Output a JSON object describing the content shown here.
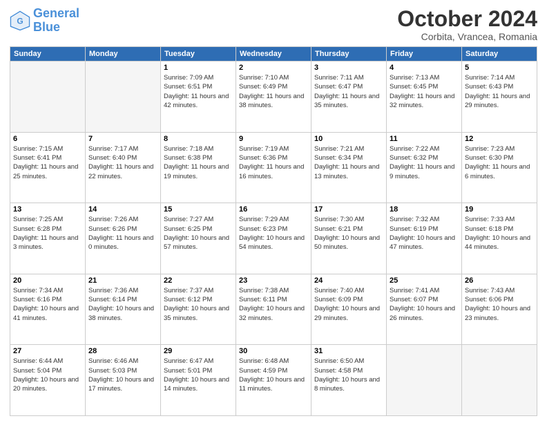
{
  "logo": {
    "line1": "General",
    "line2": "Blue"
  },
  "title": "October 2024",
  "subtitle": "Corbita, Vrancea, Romania",
  "days_header": [
    "Sunday",
    "Monday",
    "Tuesday",
    "Wednesday",
    "Thursday",
    "Friday",
    "Saturday"
  ],
  "weeks": [
    [
      {
        "day": "",
        "empty": true
      },
      {
        "day": "",
        "empty": true
      },
      {
        "day": "1",
        "sunrise": "Sunrise: 7:09 AM",
        "sunset": "Sunset: 6:51 PM",
        "daylight": "Daylight: 11 hours and 42 minutes."
      },
      {
        "day": "2",
        "sunrise": "Sunrise: 7:10 AM",
        "sunset": "Sunset: 6:49 PM",
        "daylight": "Daylight: 11 hours and 38 minutes."
      },
      {
        "day": "3",
        "sunrise": "Sunrise: 7:11 AM",
        "sunset": "Sunset: 6:47 PM",
        "daylight": "Daylight: 11 hours and 35 minutes."
      },
      {
        "day": "4",
        "sunrise": "Sunrise: 7:13 AM",
        "sunset": "Sunset: 6:45 PM",
        "daylight": "Daylight: 11 hours and 32 minutes."
      },
      {
        "day": "5",
        "sunrise": "Sunrise: 7:14 AM",
        "sunset": "Sunset: 6:43 PM",
        "daylight": "Daylight: 11 hours and 29 minutes."
      }
    ],
    [
      {
        "day": "6",
        "sunrise": "Sunrise: 7:15 AM",
        "sunset": "Sunset: 6:41 PM",
        "daylight": "Daylight: 11 hours and 25 minutes."
      },
      {
        "day": "7",
        "sunrise": "Sunrise: 7:17 AM",
        "sunset": "Sunset: 6:40 PM",
        "daylight": "Daylight: 11 hours and 22 minutes."
      },
      {
        "day": "8",
        "sunrise": "Sunrise: 7:18 AM",
        "sunset": "Sunset: 6:38 PM",
        "daylight": "Daylight: 11 hours and 19 minutes."
      },
      {
        "day": "9",
        "sunrise": "Sunrise: 7:19 AM",
        "sunset": "Sunset: 6:36 PM",
        "daylight": "Daylight: 11 hours and 16 minutes."
      },
      {
        "day": "10",
        "sunrise": "Sunrise: 7:21 AM",
        "sunset": "Sunset: 6:34 PM",
        "daylight": "Daylight: 11 hours and 13 minutes."
      },
      {
        "day": "11",
        "sunrise": "Sunrise: 7:22 AM",
        "sunset": "Sunset: 6:32 PM",
        "daylight": "Daylight: 11 hours and 9 minutes."
      },
      {
        "day": "12",
        "sunrise": "Sunrise: 7:23 AM",
        "sunset": "Sunset: 6:30 PM",
        "daylight": "Daylight: 11 hours and 6 minutes."
      }
    ],
    [
      {
        "day": "13",
        "sunrise": "Sunrise: 7:25 AM",
        "sunset": "Sunset: 6:28 PM",
        "daylight": "Daylight: 11 hours and 3 minutes."
      },
      {
        "day": "14",
        "sunrise": "Sunrise: 7:26 AM",
        "sunset": "Sunset: 6:26 PM",
        "daylight": "Daylight: 11 hours and 0 minutes."
      },
      {
        "day": "15",
        "sunrise": "Sunrise: 7:27 AM",
        "sunset": "Sunset: 6:25 PM",
        "daylight": "Daylight: 10 hours and 57 minutes."
      },
      {
        "day": "16",
        "sunrise": "Sunrise: 7:29 AM",
        "sunset": "Sunset: 6:23 PM",
        "daylight": "Daylight: 10 hours and 54 minutes."
      },
      {
        "day": "17",
        "sunrise": "Sunrise: 7:30 AM",
        "sunset": "Sunset: 6:21 PM",
        "daylight": "Daylight: 10 hours and 50 minutes."
      },
      {
        "day": "18",
        "sunrise": "Sunrise: 7:32 AM",
        "sunset": "Sunset: 6:19 PM",
        "daylight": "Daylight: 10 hours and 47 minutes."
      },
      {
        "day": "19",
        "sunrise": "Sunrise: 7:33 AM",
        "sunset": "Sunset: 6:18 PM",
        "daylight": "Daylight: 10 hours and 44 minutes."
      }
    ],
    [
      {
        "day": "20",
        "sunrise": "Sunrise: 7:34 AM",
        "sunset": "Sunset: 6:16 PM",
        "daylight": "Daylight: 10 hours and 41 minutes."
      },
      {
        "day": "21",
        "sunrise": "Sunrise: 7:36 AM",
        "sunset": "Sunset: 6:14 PM",
        "daylight": "Daylight: 10 hours and 38 minutes."
      },
      {
        "day": "22",
        "sunrise": "Sunrise: 7:37 AM",
        "sunset": "Sunset: 6:12 PM",
        "daylight": "Daylight: 10 hours and 35 minutes."
      },
      {
        "day": "23",
        "sunrise": "Sunrise: 7:38 AM",
        "sunset": "Sunset: 6:11 PM",
        "daylight": "Daylight: 10 hours and 32 minutes."
      },
      {
        "day": "24",
        "sunrise": "Sunrise: 7:40 AM",
        "sunset": "Sunset: 6:09 PM",
        "daylight": "Daylight: 10 hours and 29 minutes."
      },
      {
        "day": "25",
        "sunrise": "Sunrise: 7:41 AM",
        "sunset": "Sunset: 6:07 PM",
        "daylight": "Daylight: 10 hours and 26 minutes."
      },
      {
        "day": "26",
        "sunrise": "Sunrise: 7:43 AM",
        "sunset": "Sunset: 6:06 PM",
        "daylight": "Daylight: 10 hours and 23 minutes."
      }
    ],
    [
      {
        "day": "27",
        "sunrise": "Sunrise: 6:44 AM",
        "sunset": "Sunset: 5:04 PM",
        "daylight": "Daylight: 10 hours and 20 minutes."
      },
      {
        "day": "28",
        "sunrise": "Sunrise: 6:46 AM",
        "sunset": "Sunset: 5:03 PM",
        "daylight": "Daylight: 10 hours and 17 minutes."
      },
      {
        "day": "29",
        "sunrise": "Sunrise: 6:47 AM",
        "sunset": "Sunset: 5:01 PM",
        "daylight": "Daylight: 10 hours and 14 minutes."
      },
      {
        "day": "30",
        "sunrise": "Sunrise: 6:48 AM",
        "sunset": "Sunset: 4:59 PM",
        "daylight": "Daylight: 10 hours and 11 minutes."
      },
      {
        "day": "31",
        "sunrise": "Sunrise: 6:50 AM",
        "sunset": "Sunset: 4:58 PM",
        "daylight": "Daylight: 10 hours and 8 minutes."
      },
      {
        "day": "",
        "empty": true
      },
      {
        "day": "",
        "empty": true
      }
    ]
  ]
}
